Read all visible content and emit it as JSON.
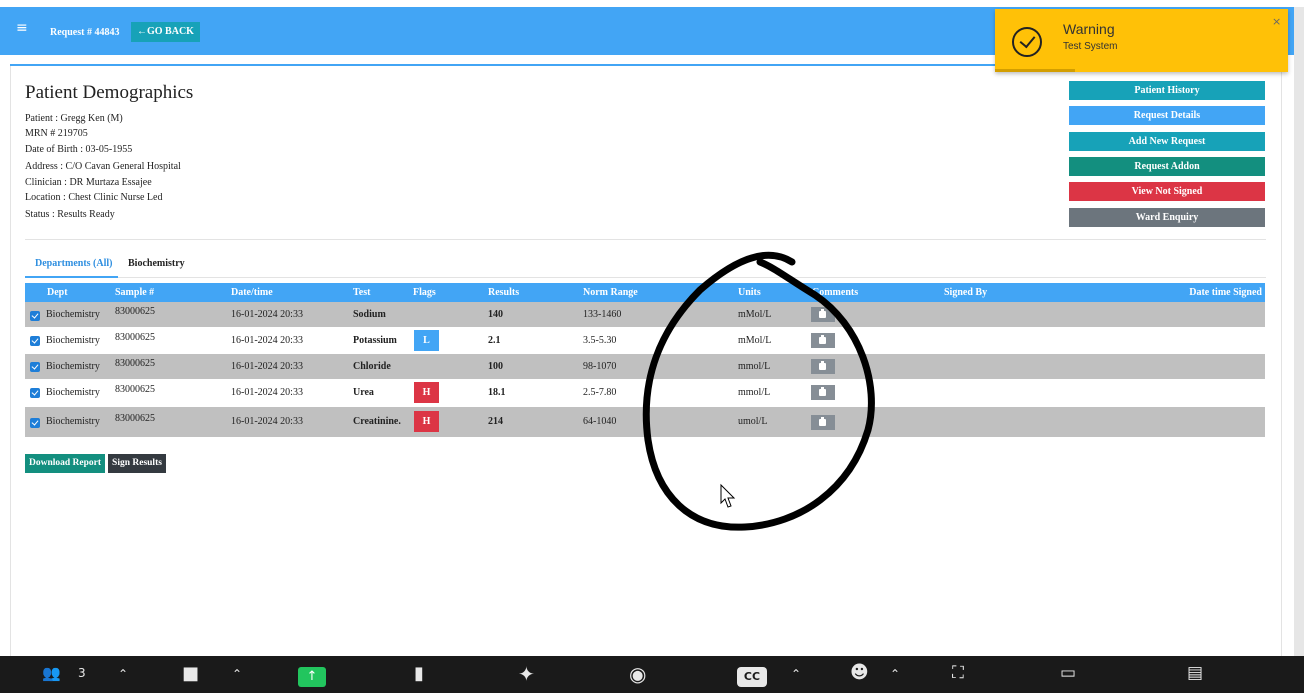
{
  "header": {
    "menu_icon": "hamburger-icon",
    "request_label": "Request # 44843",
    "go_back_label": "GO BACK"
  },
  "toast": {
    "title": "Warning",
    "message": "Test System",
    "close": "×",
    "color": "#ffc107"
  },
  "demographics": {
    "title": "Patient Demographics",
    "patient": "Patient : Gregg Ken (M)",
    "mrn": "MRN # 219705",
    "dob": "Date of Birth : 03-05-1955",
    "address": "Address : C/O Cavan General Hospital",
    "clinician": "Clinician : DR Murtaza Essajee",
    "location": "Location : Chest Clinic Nurse Led",
    "status": "Status : Results Ready"
  },
  "actions": [
    {
      "label": "Patient History",
      "color": "#17a2b8"
    },
    {
      "label": "Request Details",
      "color": "#42a5f5"
    },
    {
      "label": "Add New Request",
      "color": "#17a2b8"
    },
    {
      "label": "Request Addon",
      "color": "#138f7f"
    },
    {
      "label": "View Not Signed",
      "color": "#dc3545"
    },
    {
      "label": "Ward Enquiry",
      "color": "#6c757d"
    }
  ],
  "tabs": {
    "active": "Departments (All)",
    "other": "Biochemistry"
  },
  "table": {
    "columns": [
      "Dept",
      "Sample #",
      "Date/time",
      "Test",
      "Flags",
      "Results",
      "Norm Range",
      "Units",
      "Comments",
      "Signed By",
      "Date time Signed"
    ],
    "rows": [
      {
        "dept": "Biochemistry",
        "sample": "83000625",
        "datetime": "16-01-2024 20:33",
        "test": "Sodium",
        "flag": "",
        "result": "140",
        "range": "133-1460",
        "units": "mMol/L"
      },
      {
        "dept": "Biochemistry",
        "sample": "83000625",
        "datetime": "16-01-2024 20:33",
        "test": "Potassium",
        "flag": "L",
        "result": "2.1",
        "range": "3.5-5.30",
        "units": "mMol/L"
      },
      {
        "dept": "Biochemistry",
        "sample": "83000625",
        "datetime": "16-01-2024 20:33",
        "test": "Chloride",
        "flag": "",
        "result": "100",
        "range": "98-1070",
        "units": "mmol/L"
      },
      {
        "dept": "Biochemistry",
        "sample": "83000625",
        "datetime": "16-01-2024 20:33",
        "test": "Urea",
        "flag": "H",
        "result": "18.1",
        "range": "2.5-7.80",
        "units": "mmol/L"
      },
      {
        "dept": "Biochemistry",
        "sample": "83000625",
        "datetime": "16-01-2024 20:33",
        "test": "Creatinine.",
        "flag": "H",
        "result": "214",
        "range": "64-1040",
        "units": "umol/L"
      }
    ]
  },
  "bottom_buttons": {
    "download": "Download Report",
    "sign": "Sign Results"
  },
  "taskbar": {
    "participants_count": "3",
    "cc_label": "CC",
    "icons": [
      "participants-icon",
      "chat-icon",
      "share-screen-icon",
      "document-icon",
      "ai-sparkle-icon",
      "record-icon",
      "captions-icon",
      "reactions-icon",
      "apps-icon",
      "whiteboard-icon",
      "notes-icon"
    ]
  }
}
